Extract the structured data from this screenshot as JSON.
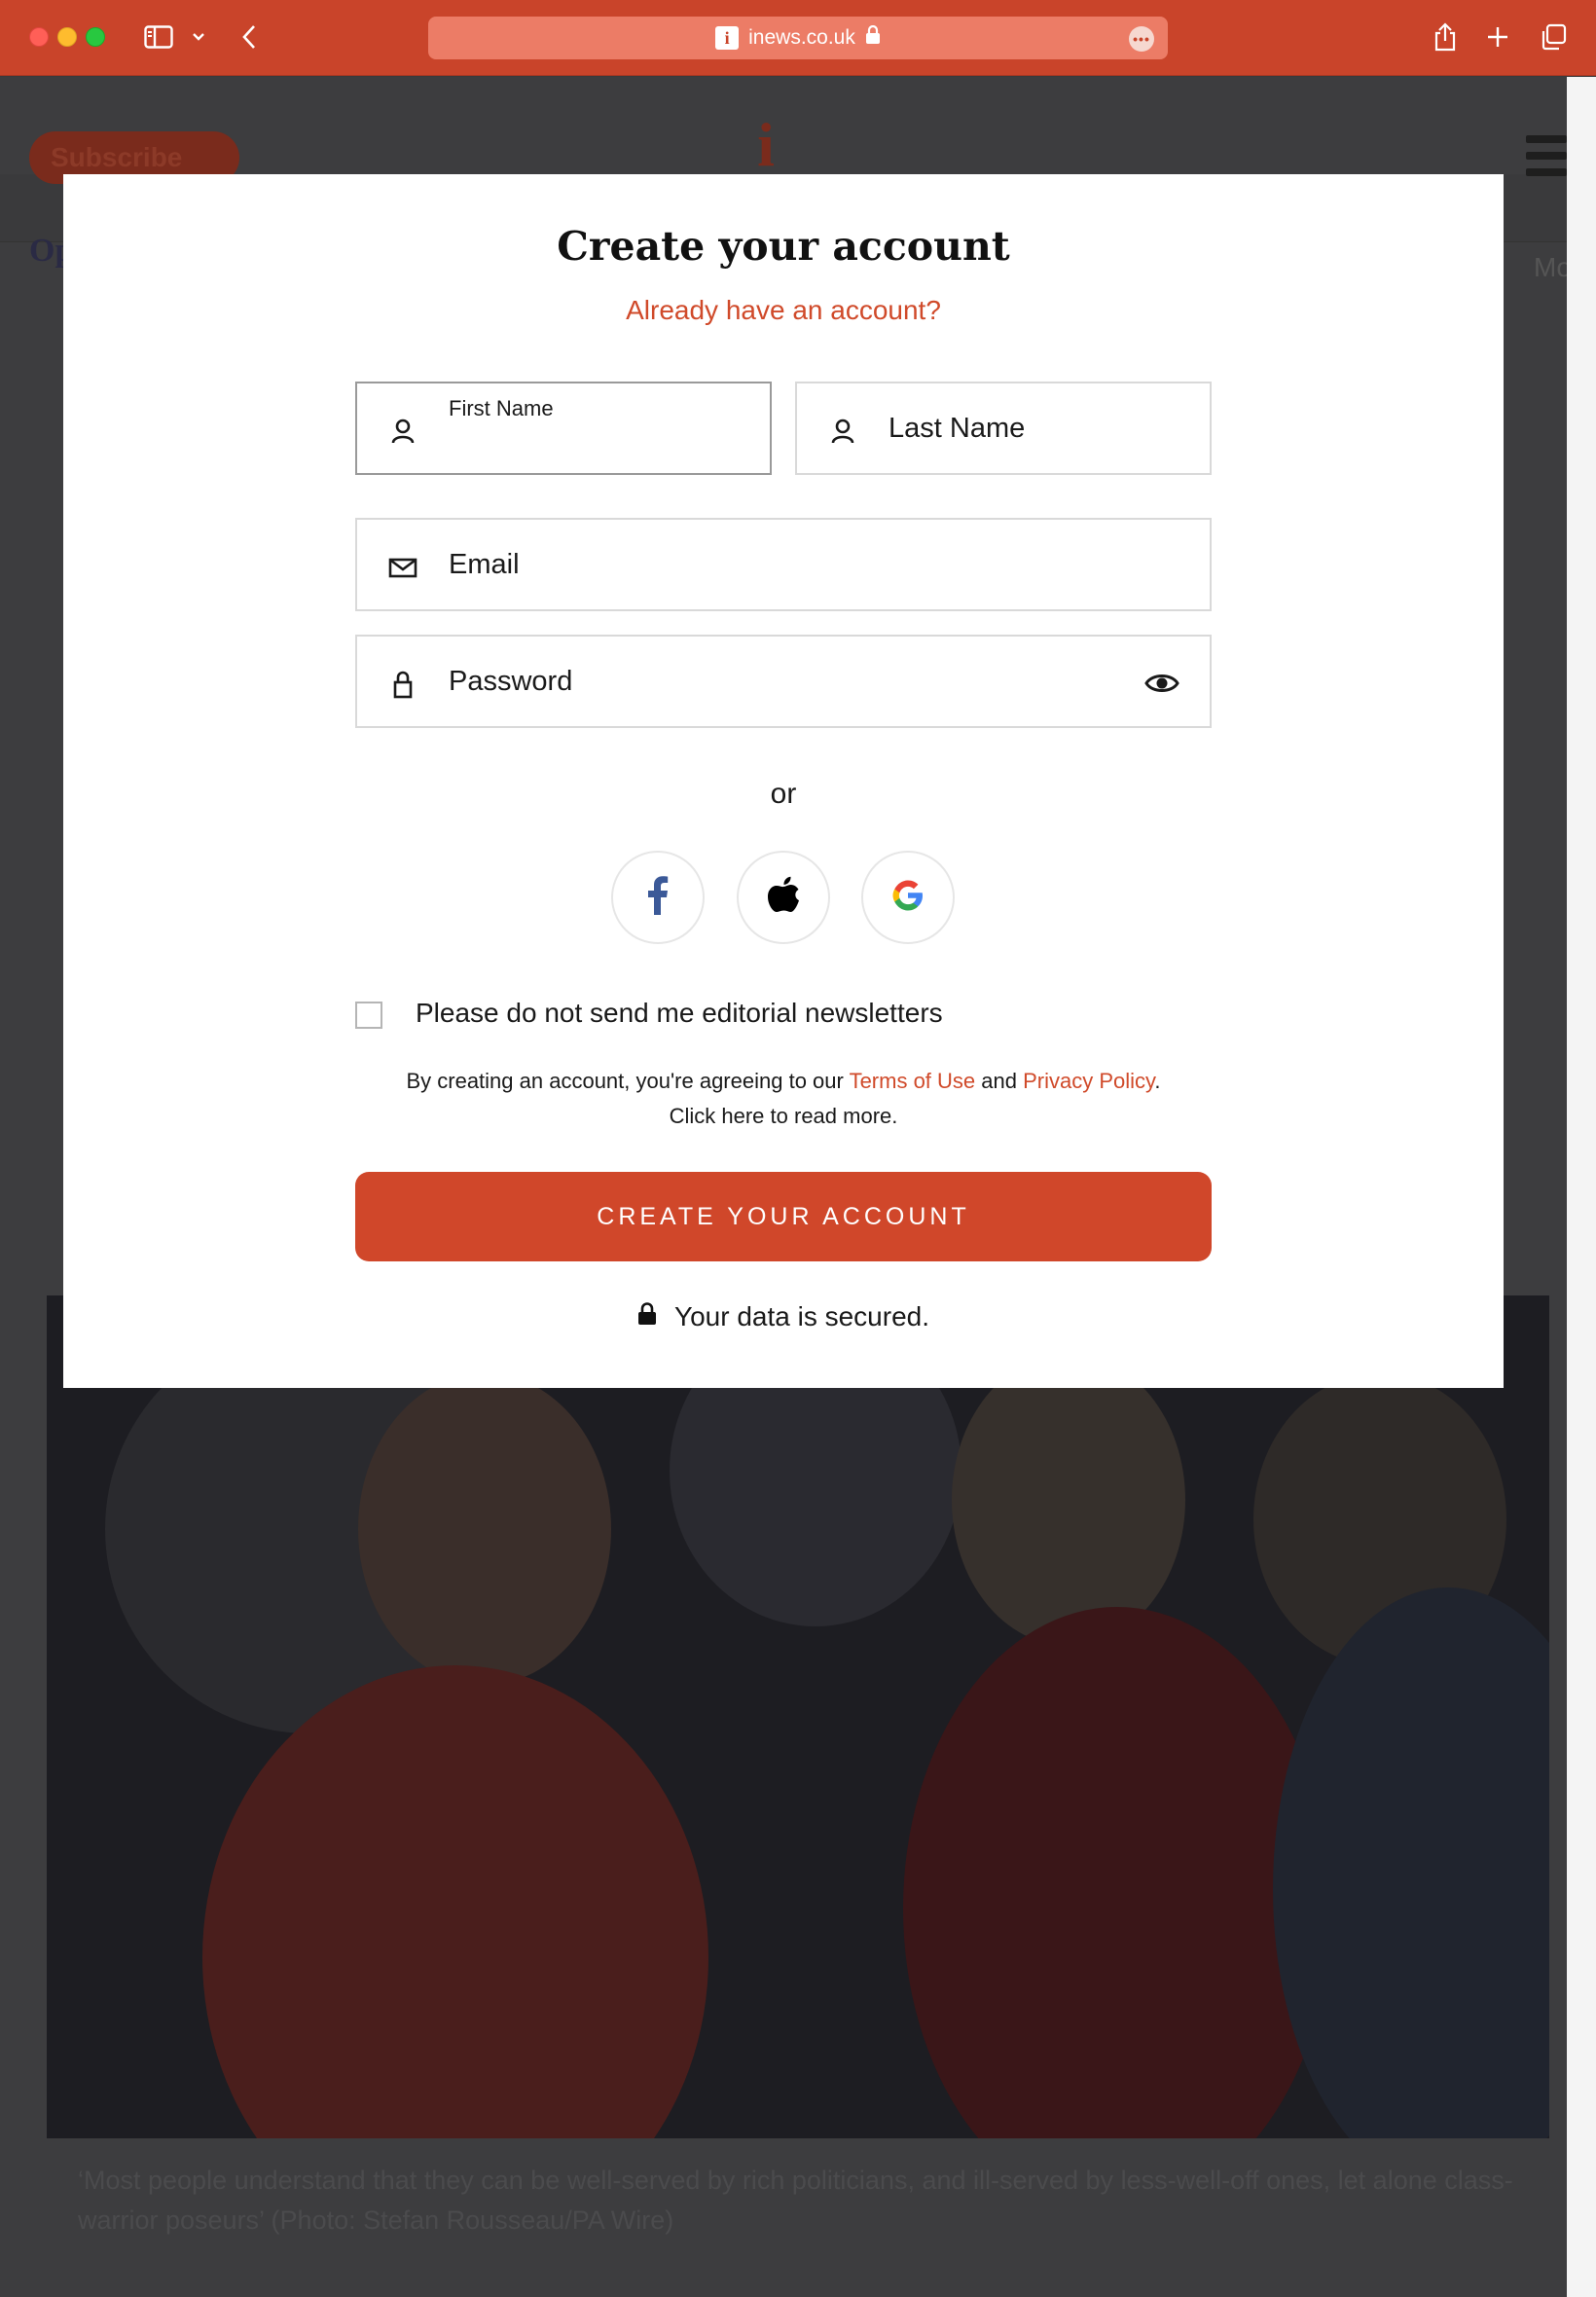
{
  "browser": {
    "url": "inews.co.uk",
    "favicon_letter": "i"
  },
  "page": {
    "subscribe_label": "Subscribe",
    "logo_letter": "i",
    "nav_left_text": "Op",
    "nav_right_text": "Mo",
    "caption": "‘Most people understand that they can be well-served by rich politicians, and ill-served by less-well-off ones, let alone class-warrior poseurs’ (Photo: Stefan Rousseau/PA Wire)"
  },
  "modal": {
    "title": "Create your account",
    "login_link": "Already have an account?",
    "first_name_label": "First Name",
    "last_name_label": "Last Name",
    "email_label": "Email",
    "password_label": "Password",
    "or_text": "or",
    "newsletter_label": "Please do not send me editorial newsletters",
    "legal_prefix": "By creating an account, you're agreeing to our ",
    "terms_link": "Terms of Use",
    "legal_and": " and ",
    "privacy_link": "Privacy Policy",
    "legal_suffix": ".",
    "legal_line2": "Click here to read more.",
    "cta_label": "CREATE YOUR ACCOUNT",
    "secure_text": "Your data is secured."
  },
  "colors": {
    "brand": "#c9442a",
    "accent": "#d0472a",
    "link": "#d04a2a"
  }
}
